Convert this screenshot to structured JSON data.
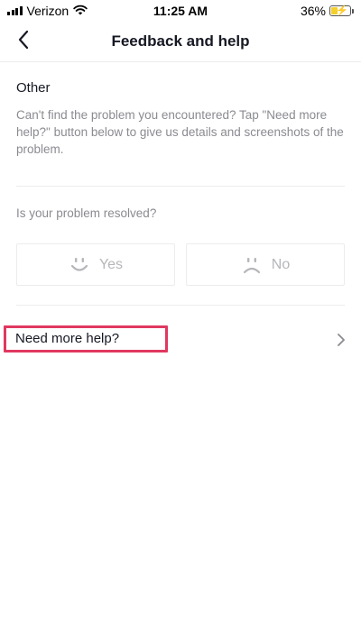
{
  "status_bar": {
    "carrier": "Verizon",
    "time": "11:25 AM",
    "battery": "36%",
    "battery_level": 0.36,
    "colors": {
      "battery_fill": "#f5cf2a"
    }
  },
  "nav": {
    "title": "Feedback and help",
    "back_icon": "chevron-left-icon"
  },
  "section": {
    "title": "Other",
    "description": "Can't find the problem you encountered? Tap \"Need more help?\" button below to give us details and screenshots of the problem."
  },
  "resolution": {
    "question": "Is your problem resolved?",
    "yes_label": "Yes",
    "no_label": "No",
    "yes_icon": "smile-face-icon",
    "no_icon": "frown-face-icon"
  },
  "help": {
    "label": "Need more help?",
    "chevron_icon": "chevron-right-icon",
    "highlight_color": "#e0385f"
  }
}
